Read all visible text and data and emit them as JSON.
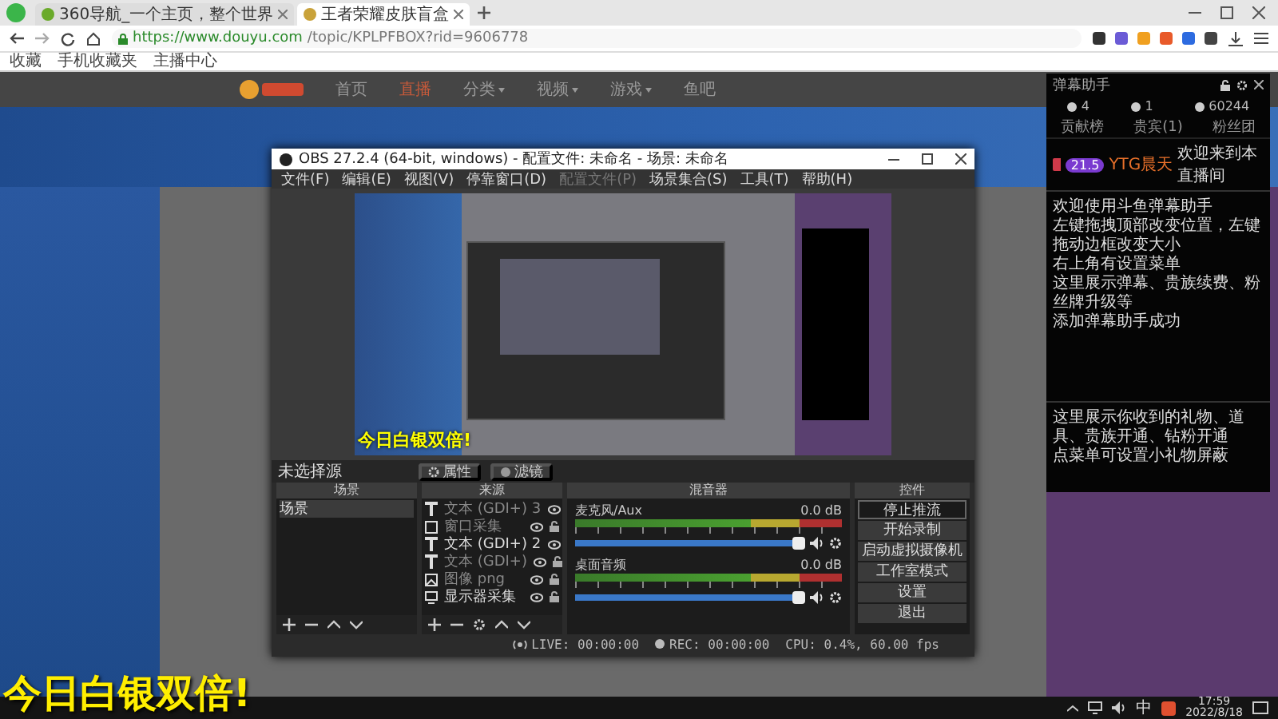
{
  "browser": {
    "tabs": [
      {
        "title": "360导航_一个主页，整个世界",
        "selected": false
      },
      {
        "title": "王者荣耀皮肤盲盒",
        "selected": true
      }
    ],
    "url_host": "https://www.douyu.com",
    "url_path": "/topic/KPLPFBOX?rid=9606778",
    "bookmarks": [
      "收藏",
      "手机收藏夹",
      "主播中心"
    ]
  },
  "site": {
    "nav": [
      {
        "label": "首页",
        "selected": false,
        "dropdown": false
      },
      {
        "label": "直播",
        "selected": true,
        "dropdown": false
      },
      {
        "label": "分类",
        "selected": false,
        "dropdown": true
      },
      {
        "label": "视频",
        "selected": false,
        "dropdown": true
      },
      {
        "label": "游戏",
        "selected": false,
        "dropdown": true
      },
      {
        "label": "鱼吧",
        "selected": false,
        "dropdown": false
      }
    ]
  },
  "obs": {
    "title": "OBS 27.2.4 (64-bit, windows) - 配置文件: 未命名 - 场景: 未命名",
    "menu": [
      {
        "label": "文件(F)",
        "disabled": false
      },
      {
        "label": "编辑(E)",
        "disabled": false
      },
      {
        "label": "视图(V)",
        "disabled": false
      },
      {
        "label": "停靠窗口(D)",
        "disabled": false
      },
      {
        "label": "配置文件(P)",
        "disabled": true
      },
      {
        "label": "场景集合(S)",
        "disabled": false
      },
      {
        "label": "工具(T)",
        "disabled": false
      },
      {
        "label": "帮助(H)",
        "disabled": false
      }
    ],
    "preview_caption": "今日白银双倍!",
    "source_bar": {
      "label": "未选择源",
      "buttons": [
        "属性",
        "滤镜"
      ]
    },
    "scenes": {
      "title": "场景",
      "items": [
        {
          "name": "场景",
          "selected": true
        }
      ]
    },
    "sources": {
      "title": "来源",
      "items": [
        {
          "kind": "text",
          "name": "文本 (GDI+) 3",
          "visible": false
        },
        {
          "kind": "window",
          "name": "窗口采集",
          "visible": false
        },
        {
          "kind": "text",
          "name": "文本 (GDI+) 2",
          "visible": true
        },
        {
          "kind": "text",
          "name": "文本 (GDI+)",
          "visible": false
        },
        {
          "kind": "image",
          "name": "图像 png",
          "visible": false
        },
        {
          "kind": "display",
          "name": "显示器采集",
          "visible": true
        }
      ]
    },
    "mixer": {
      "title": "混音器",
      "channels": [
        {
          "name": "麦克风/Aux",
          "reading": "0.0 dB",
          "level": 0.97
        },
        {
          "name": "桌面音频",
          "reading": "0.0 dB",
          "level": 0.97
        }
      ]
    },
    "controls": {
      "title": "控件",
      "buttons": [
        {
          "label": "停止推流",
          "active": true
        },
        {
          "label": "开始录制",
          "active": false
        },
        {
          "label": "启动虚拟摄像机",
          "active": false
        },
        {
          "label": "工作室模式",
          "active": false
        },
        {
          "label": "设置",
          "active": false
        },
        {
          "label": "退出",
          "active": false
        }
      ]
    },
    "status": {
      "live": "LIVE: 00:00:00",
      "rec": "REC: 00:00:00",
      "cpu": "CPU: 0.4%, 60.00 fps"
    }
  },
  "helper": {
    "title": "弹幕助手",
    "stats": [
      "4",
      "1",
      "60244"
    ],
    "tabs": [
      "贡献榜",
      "贵宾(1)",
      "粉丝团"
    ],
    "welcome": {
      "level": "21.5",
      "user": "YTG晨天",
      "text": "欢迎来到本直播间"
    },
    "messages": [
      "欢迎使用斗鱼弹幕助手",
      "左键拖拽顶部改变位置，左键拖动边框改变大小",
      "右上角有设置菜单",
      "这里展示弹幕、贵族续费、粉丝牌升级等",
      "添加弹幕助手成功"
    ],
    "gift_messages": [
      "这里展示你收到的礼物、道具、贵族开通、钻粉开通",
      "点菜单可设置小礼物屏蔽"
    ]
  },
  "caption": "今日白银双倍!",
  "taskbar": {
    "ime": "中",
    "time": "17:59",
    "date": "2022/8/18"
  }
}
